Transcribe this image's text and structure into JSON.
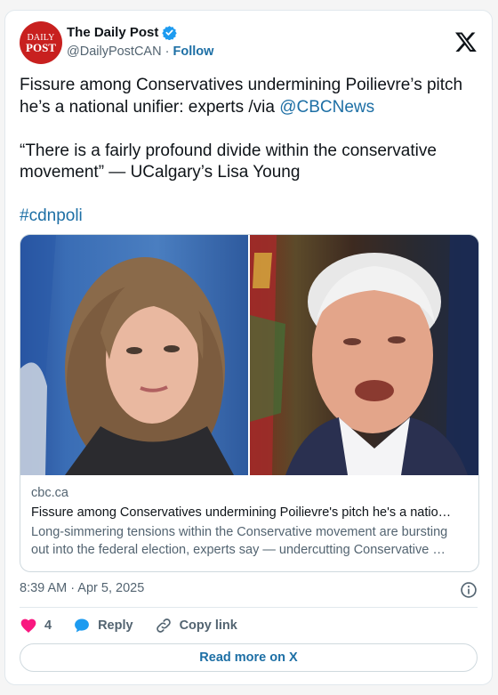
{
  "account": {
    "name": "The Daily Post",
    "handle": "@DailyPostCAN",
    "separator": "·",
    "follow_label": "Follow",
    "avatar_line1": "DAILY",
    "avatar_line2": "POST"
  },
  "tweet": {
    "line1_text": "Fissure among Conservatives undermining Poilievre’s pitch he’s a national unifier: experts /via ",
    "line1_mention": "@CBCNews",
    "quote": "“There is a fairly profound divide within the conservative movement” — UCalgary’s Lisa Young",
    "hashtag": "#cdnpoli"
  },
  "link_card": {
    "domain": "cbc.ca",
    "title": "Fissure among Conservatives undermining Poilievre's pitch he's a natio…",
    "desc_line1": "Long-simmering tensions within the Conservative movement are bursting",
    "desc_line2": "out into the federal election, experts say — undercutting Conservative …"
  },
  "timestamp": "8:39 AM · Apr 5, 2025",
  "actions": {
    "like_count": "4",
    "reply_label": "Reply",
    "copy_label": "Copy link"
  },
  "read_more_label": "Read more on X",
  "colors": {
    "link": "#1d6fa5",
    "like": "#f91880",
    "verified": "#1d9bf0",
    "avatar": "#c8201f"
  },
  "icons": [
    "verified-badge-icon",
    "x-logo-icon",
    "info-icon",
    "heart-icon",
    "reply-bubble-icon",
    "link-icon"
  ]
}
